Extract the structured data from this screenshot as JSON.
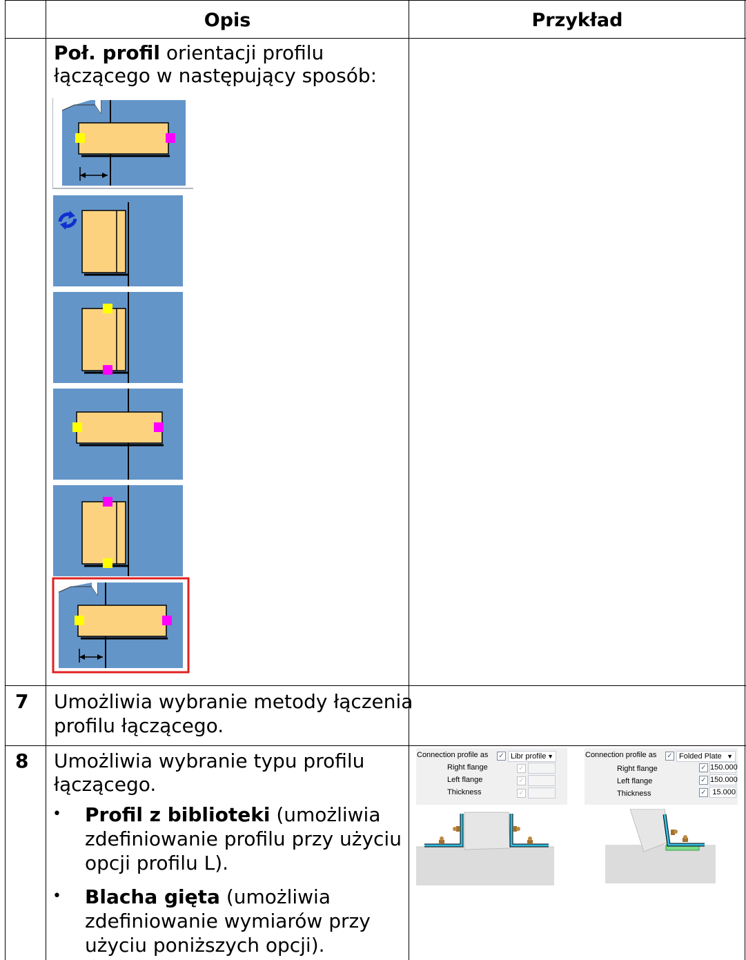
{
  "table": {
    "headers": {
      "col_desc": "Opis",
      "col_example": "Przykład"
    },
    "row_orient": {
      "lead_bold": "Poł. profil",
      "line1_rest": " orientacji profilu",
      "line2": "łączącego w następujący sposób:"
    },
    "row7": {
      "number": "7",
      "line1": "Umożliwia wybranie metody łączenia",
      "line2": "profilu łączącego."
    },
    "row8": {
      "number": "8",
      "line1": "Umożliwia wybranie typu profilu",
      "line2": "łączącego.",
      "bullet1": {
        "bold": "Profil z biblioteki",
        "rest1": " (umożliwia",
        "line2": "zdefiniowanie profilu przy użyciu",
        "line3": "opcji profilu L)."
      },
      "bullet2": {
        "bold": "Blacha gięta",
        "rest1": " (umożliwia",
        "line2": "zdefiniowanie wymiarów przy",
        "line3": "użyciu poniższych opcji)."
      },
      "panel_left": {
        "label_conn": "Connection profile as",
        "select": "Libr profile",
        "label_right": "Right flange",
        "label_left": "Left flange",
        "label_thick": "Thickness"
      },
      "panel_right": {
        "label_conn": "Connection profile as",
        "select": "Folded Plate",
        "label_right": "Right flange",
        "label_left": "Left flange",
        "label_thick": "Thickness",
        "right_value": "150.000",
        "left_value": "150.000",
        "thick_value": "15.000"
      }
    }
  },
  "colors": {
    "tile_blue": "#6495c9",
    "profile_fill": "#fcd27f",
    "yellow_handle": "#ffff00",
    "magenta_handle": "#ff00ff",
    "selected_border": "#e02020"
  }
}
